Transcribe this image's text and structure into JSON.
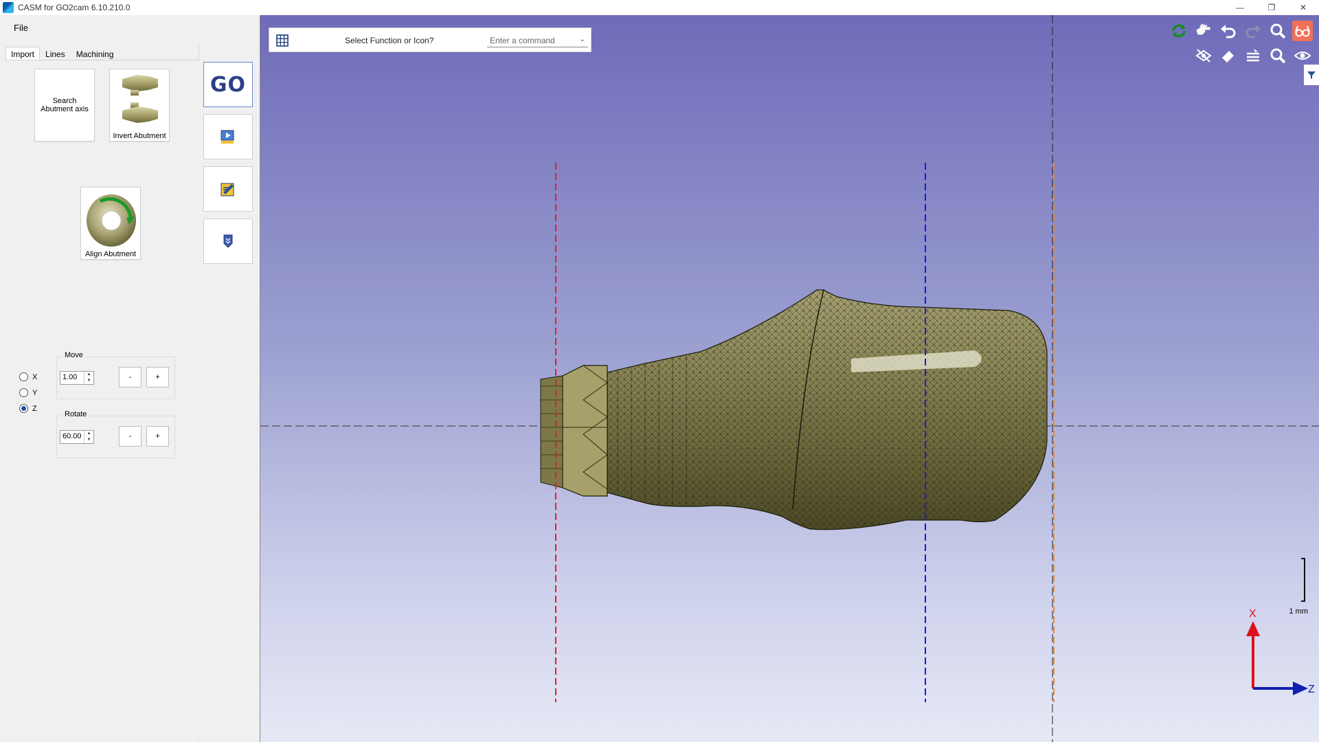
{
  "window": {
    "title": "CASM for GO2cam 6.10.210.0"
  },
  "menu": {
    "file": "File"
  },
  "tabs": [
    "Import",
    "Lines",
    "Machining"
  ],
  "tools": {
    "search_axis": "Search Abutment axis",
    "invert": "Invert Abutment",
    "align": "Align Abutment"
  },
  "axis_radios": [
    {
      "label": "X",
      "checked": false
    },
    {
      "label": "Y",
      "checked": false
    },
    {
      "label": "Z",
      "checked": true
    }
  ],
  "move": {
    "title": "Move",
    "value": "1.00",
    "minus": "-",
    "plus": "+"
  },
  "rotate": {
    "title": "Rotate",
    "value": "60.00",
    "minus": "-",
    "plus": "+"
  },
  "side_toolbar": {
    "go_label": "GO"
  },
  "command_bar": {
    "label": "Select Function or Icon?",
    "placeholder": "Enter a command"
  },
  "scale": {
    "label": "1 mm"
  },
  "axes": {
    "vertical": "X",
    "horizontal": "Z"
  },
  "colors": {
    "go_blue": "#2d3e88",
    "model": "#8f8a58",
    "red_line": "#e0202a",
    "blue_line": "#1818e0",
    "orange_line": "#f08a20"
  }
}
